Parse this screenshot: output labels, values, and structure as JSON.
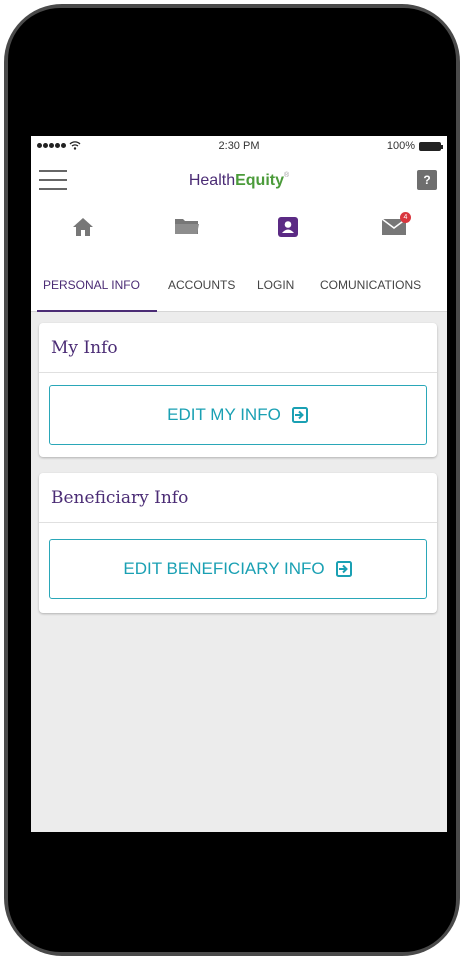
{
  "status_bar": {
    "time": "2:30 PM",
    "battery_percent": "100%"
  },
  "header": {
    "brand_part1": "Health",
    "brand_part2": "Equity",
    "trademark": "®",
    "help_label": "?"
  },
  "icon_nav": {
    "items": [
      "home-icon",
      "folder-icon",
      "profile-icon",
      "mail-icon"
    ],
    "mail_badge_count": "4",
    "active_color": "#5b2a84",
    "inactive_color": "#777777",
    "badge_color": "#d9363e"
  },
  "tabs": [
    {
      "label": "PERSONAL INFO"
    },
    {
      "label": "ACCOUNTS"
    },
    {
      "label": "LOGIN"
    },
    {
      "label": "COMUNICATIONS"
    }
  ],
  "my_info": {
    "title": "My Info",
    "button_label": "EDIT MY INFO"
  },
  "beneficiary_info": {
    "title": "Beneficiary Info",
    "button_label": "EDIT BENEFICIARY INFO"
  },
  "colors": {
    "brand_purple": "#4b2c75",
    "brand_green": "#4b9b3a",
    "accent_teal": "#1aa0b3"
  }
}
